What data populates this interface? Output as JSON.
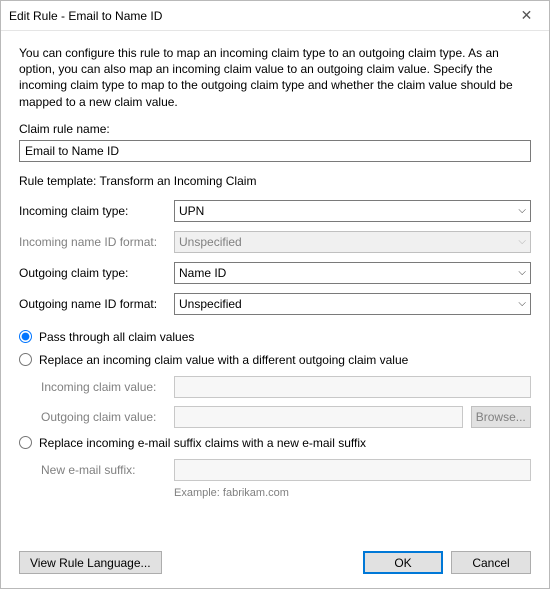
{
  "title": "Edit Rule - Email to Name ID",
  "description": "You can configure this rule to map an incoming claim type to an outgoing claim type. As an option, you can also map an incoming claim value to an outgoing claim value. Specify the incoming claim type to map to the outgoing claim type and whether the claim value should be mapped to a new claim value.",
  "labels": {
    "claim_rule_name": "Claim rule name:",
    "rule_template_prefix": "Rule template: ",
    "incoming_claim_type": "Incoming claim type:",
    "incoming_name_id_format": "Incoming name ID format:",
    "outgoing_claim_type": "Outgoing claim type:",
    "outgoing_name_id_format": "Outgoing name ID format:",
    "incoming_claim_value": "Incoming claim value:",
    "outgoing_claim_value": "Outgoing claim value:",
    "new_email_suffix": "New e-mail suffix:",
    "example": "Example: fabrikam.com"
  },
  "values": {
    "claim_rule_name": "Email to Name ID",
    "rule_template": "Transform an Incoming Claim",
    "incoming_claim_type": "UPN",
    "incoming_name_id_format": "Unspecified",
    "outgoing_claim_type": "Name ID",
    "outgoing_name_id_format": "Unspecified",
    "incoming_claim_value": "",
    "outgoing_claim_value": "",
    "new_email_suffix": ""
  },
  "radios": {
    "pass_through": "Pass through all claim values",
    "replace_value": "Replace an incoming claim value with a different outgoing claim value",
    "replace_suffix": "Replace incoming e-mail suffix claims with a new e-mail suffix",
    "selected": "pass_through"
  },
  "buttons": {
    "browse": "Browse...",
    "view_rule_language": "View Rule Language...",
    "ok": "OK",
    "cancel": "Cancel"
  }
}
